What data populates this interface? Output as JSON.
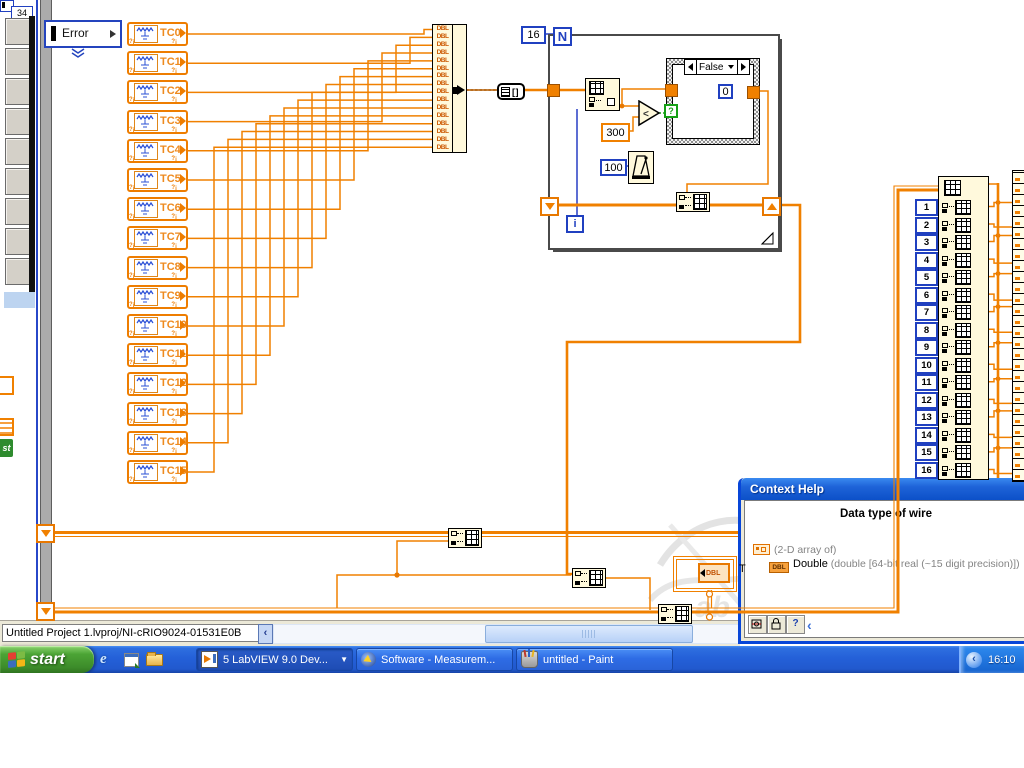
{
  "window_behind": {
    "array_index": "34",
    "badge": "st"
  },
  "diagram": {
    "error_label": "Error",
    "tc_channels": [
      "TC0",
      "TC1",
      "TC2",
      "TC3",
      "TC4",
      "TC5",
      "TC6",
      "TC7",
      "TC8",
      "TC9",
      "TC10",
      "TC11",
      "TC12",
      "TC13",
      "TC14",
      "TC15"
    ],
    "build_array_rows": [
      "DBL",
      "DBL",
      "DBL",
      "DBL",
      "DBL",
      "DBL",
      "DBL",
      "DBL",
      "DBL",
      "DBL",
      "DBL",
      "DBL",
      "DBL",
      "DBL",
      "DBL",
      "DBL"
    ],
    "constants": {
      "loop_count": "16",
      "loop_terminal": "N",
      "threshold": "300",
      "wait_ms": "100",
      "case_value": "0",
      "iteration": "i",
      "selector_unknown": "?"
    },
    "case_selector": "False",
    "index_constants": [
      "1",
      "2",
      "3",
      "4",
      "5",
      "6",
      "7",
      "8",
      "9",
      "10",
      "11",
      "12",
      "13",
      "14",
      "15",
      "16"
    ],
    "indicator": {
      "label": "T",
      "type": "DBL"
    }
  },
  "status_bar": {
    "path": "Untitled Project 1.lvproj/NI-cRIO9024-01531E0B"
  },
  "context_help": {
    "title": "Context Help",
    "heading": "Data type of wire",
    "array_line": "(2-D array of)",
    "type_name": "Double",
    "type_desc": "(double [64-bit real (~15 digit precision)])",
    "dbl_chip": "DBL",
    "help_button": "?"
  },
  "taskbar": {
    "start": "start",
    "buttons": [
      "5 LabVIEW 9.0 Dev...",
      "Software - Measurem...",
      "untitled - Paint"
    ],
    "clock": "16:10"
  },
  "colors": {
    "wire_orange": "#F08000",
    "node_yellow": "#FFF9DC",
    "int_blue": "#2040C0",
    "taskbar_blue": "#2663DE",
    "start_green": "#4CA435"
  }
}
